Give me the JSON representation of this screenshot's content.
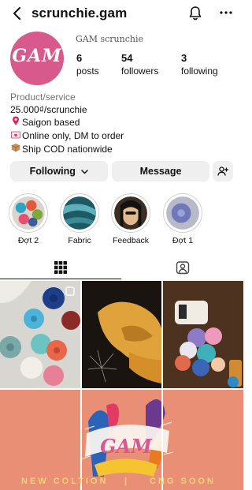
{
  "header": {
    "username": "scrunchie.gam"
  },
  "profile": {
    "avatar_text": "GAM",
    "display_name": "GAM scrunchie",
    "stats": {
      "posts_count": "6",
      "posts_label": "posts",
      "followers_count": "54",
      "followers_label": "followers",
      "following_count": "3",
      "following_label": "following"
    },
    "bio": {
      "category": "Product/service",
      "lines": [
        "25.000₫/scrunchie",
        "Saigon based",
        "Online only, DM to order",
        "Ship COD nationwide"
      ]
    }
  },
  "actions": {
    "following_label": "Following",
    "message_label": "Message"
  },
  "highlights": [
    {
      "label": "Đợt 2"
    },
    {
      "label": "Fabric"
    },
    {
      "label": "Feedback"
    },
    {
      "label": "Đợt 1"
    }
  ],
  "grid": {
    "banner_left": "NEW COLTION",
    "banner_right": "CNG SOON",
    "banner_logo": "GAM"
  },
  "colors": {
    "avatar_bg": "#d85a8c",
    "button_bg": "#efefef",
    "banner_bg": "#e98f76"
  },
  "icons": [
    "back-icon",
    "bell-icon",
    "more-icon",
    "add-user-icon",
    "grid-icon",
    "tagged-icon"
  ]
}
